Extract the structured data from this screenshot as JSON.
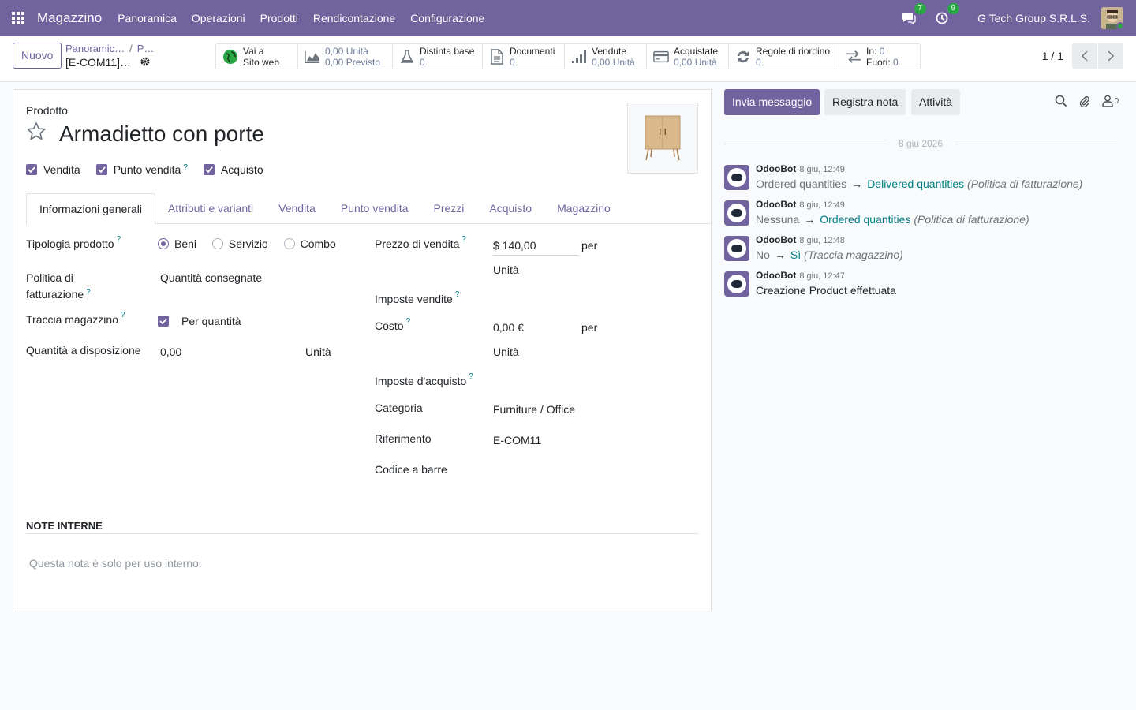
{
  "navbar": {
    "app_name": "Magazzino",
    "menu": [
      "Panoramica",
      "Operazioni",
      "Prodotti",
      "Rendicontazione",
      "Configurazione"
    ],
    "messages_count": "7",
    "activities_count": "9",
    "company": "G Tech Group S.R.L.S."
  },
  "control": {
    "new_label": "Nuovo",
    "breadcrumb": [
      "Panoramic…",
      "P…"
    ],
    "record_name": "[E-COM11]…",
    "pager": "1 / 1"
  },
  "smart_buttons": {
    "website": {
      "line1": "Vai a",
      "line2": "Sito web"
    },
    "forecast": {
      "v1": "0,00",
      "u1": "Unità",
      "v2": "0,00",
      "u2": "Previsto"
    },
    "bom": {
      "label": "Distinta base",
      "value": "0"
    },
    "docs": {
      "label": "Documenti",
      "value": "0"
    },
    "sold": {
      "label": "Vendute",
      "value": "0,00 Unità"
    },
    "purchased": {
      "label": "Acquistate",
      "value": "0,00 Unità"
    },
    "reorder": {
      "label": "Regole di riordino",
      "value": "0"
    },
    "moves": {
      "in_label": "In:",
      "in_value": "0",
      "out_label": "Fuori:",
      "out_value": "0"
    }
  },
  "product": {
    "label": "Prodotto",
    "name": "Armadietto con porte",
    "checks": {
      "sale": "Vendita",
      "pos": "Punto vendita",
      "purchase": "Acquisto"
    }
  },
  "tabs": [
    "Informazioni generali",
    "Attributi e varianti",
    "Vendita",
    "Punto vendita",
    "Prezzi",
    "Acquisto",
    "Magazzino"
  ],
  "general": {
    "type_label": "Tipologia prodotto",
    "type_options": [
      "Beni",
      "Servizio",
      "Combo"
    ],
    "invoice_policy_label_1": "Politica di",
    "invoice_policy_label_2": "fatturazione",
    "invoice_policy_value": "Quantità consegnate",
    "track_label": "Traccia magazzino",
    "track_value": "Per quantità",
    "qty_label": "Quantità a disposizione",
    "qty_value": "0,00",
    "qty_uom": "Unità",
    "price_label": "Prezzo di vendita",
    "price_value": "$ 140,00",
    "per": "per",
    "price_uom": "Unità",
    "sale_taxes_label": "Imposte vendite",
    "cost_label": "Costo",
    "cost_value": "0,00 €",
    "cost_uom": "Unità",
    "purchase_taxes_label": "Imposte d'acquisto",
    "category_label": "Categoria",
    "category_value": "Furniture / Office",
    "ref_label": "Riferimento",
    "ref_value": "E-COM11",
    "barcode_label": "Codice a barre",
    "help": "?"
  },
  "notes": {
    "title": "NOTE INTERNE",
    "placeholder": "Questa nota è solo per uso interno."
  },
  "chatter": {
    "send_message": "Invia messaggio",
    "log_note": "Registra nota",
    "activities": "Attività",
    "followers_count": "0",
    "date_separator": "8 giu 2026",
    "messages": [
      {
        "author": "OdooBot",
        "date": "8 giu, 12:49",
        "old": "Ordered quantities",
        "new": "Delivered quantities",
        "field": "(Politica di fatturazione)"
      },
      {
        "author": "OdooBot",
        "date": "8 giu, 12:49",
        "old": "Nessuna",
        "new": "Ordered quantities",
        "field": "(Politica di fatturazione)"
      },
      {
        "author": "OdooBot",
        "date": "8 giu, 12:48",
        "old": "No",
        "new": "Sì",
        "field": "(Traccia magazzino)"
      },
      {
        "author": "OdooBot",
        "date": "8 giu, 12:47",
        "text": "Creazione Product effettuata"
      }
    ]
  }
}
